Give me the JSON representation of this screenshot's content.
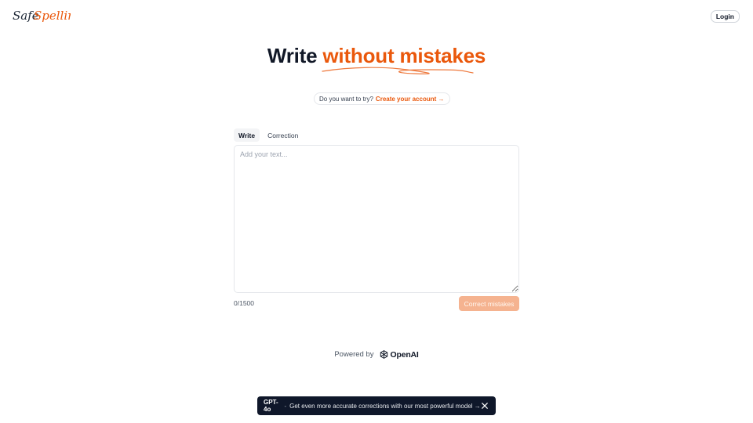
{
  "header": {
    "logo_text": "SafeSpelling",
    "login_label": "Login"
  },
  "hero": {
    "title_plain": "Write",
    "title_accent": "without mistakes"
  },
  "try_pill": {
    "question": "Do you want to try?",
    "link_label": "Create your account →"
  },
  "tabs": [
    {
      "label": "Write",
      "active": true
    },
    {
      "label": "Correction",
      "active": false
    }
  ],
  "editor": {
    "placeholder": "Add your text...",
    "value": ""
  },
  "counter": "0/1500",
  "correct_button_label": "Correct mistakes",
  "powered": {
    "prefix": "Powered by",
    "brand": "OpenAI"
  },
  "banner": {
    "model": "GPT-4o",
    "separator": "-",
    "message": "Get even more accurate corrections with our most powerful model →"
  },
  "colors": {
    "accent": "#ea580c",
    "button_disabled": "#f5b390",
    "banner_bg": "#0f172a"
  }
}
